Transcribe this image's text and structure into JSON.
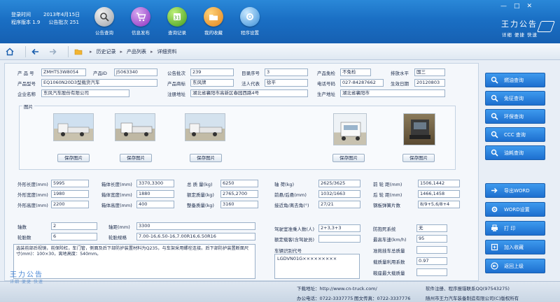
{
  "header": {
    "login_time_label": "登录时间",
    "login_time_value": "2013年4月15日",
    "version_label": "程序版本 1.9",
    "announce_label": "公告批次 251",
    "nav": [
      {
        "label": "公告查询",
        "icon": "search-car-icon"
      },
      {
        "label": "信息发布",
        "icon": "cart-icon"
      },
      {
        "label": "查询记录",
        "icon": "calendar-icon"
      },
      {
        "label": "我的收藏",
        "icon": "folder-icon"
      },
      {
        "label": "程序设置",
        "icon": "gear-icon"
      }
    ],
    "brand_title": "王力公告",
    "brand_slogan": "详细 便捷 快速",
    "window_controls": [
      "—",
      "□",
      "✕"
    ]
  },
  "toolbar": {
    "history": "历史记录",
    "product_list": "产品列表",
    "detail": "详细资料"
  },
  "fields_top": [
    {
      "label": "产 品 号",
      "value": "ZMHT53W8054"
    },
    {
      "label": "产品ID",
      "value": "J5063340"
    },
    {
      "label": "公告批次",
      "value": "239"
    },
    {
      "label": "目录序号",
      "value": "3"
    },
    {
      "label": "产品免检",
      "value": "不免检"
    },
    {
      "label": "排放水平",
      "value": "国三"
    },
    {
      "label": "产品型号",
      "value": "EQ1060N20D3型载货汽车"
    },
    {
      "label": "产品商标",
      "value": "东风牌"
    },
    {
      "label": "法人代表",
      "value": "徐平"
    },
    {
      "label": "电话号码",
      "value": "027-84287662"
    },
    {
      "label": "生效日期",
      "value": "20120803"
    },
    {
      "label": "企业名称",
      "value": "东风汽车股份有限公司"
    },
    {
      "label": "注册地址",
      "value": "湖北省襄阳市高新区春园西路4号"
    },
    {
      "label": "生产地址",
      "value": "湖北省襄阳市"
    }
  ],
  "photos": {
    "title": "图片",
    "save_label": "保存图片"
  },
  "specs_left": [
    {
      "label": "外形长度(mm)",
      "value": "5995"
    },
    {
      "label": "外形宽度(mm)",
      "value": "1980"
    },
    {
      "label": "外形高度(mm)",
      "value": "2200"
    }
  ],
  "specs_box": [
    {
      "label": "箱体长度(mm)",
      "value": "3370,3300"
    },
    {
      "label": "箱体宽度(mm)",
      "value": "1880"
    },
    {
      "label": "箱体高度(mm)",
      "value": "400"
    }
  ],
  "specs_mass": [
    {
      "label": "总 质 量(kg)",
      "value": "6250"
    },
    {
      "label": "额定质量(kg)",
      "value": "2765,2700"
    },
    {
      "label": "整备质量(kg)",
      "value": "3160"
    }
  ],
  "specs_axle": [
    {
      "label": "轴 荷(kg)",
      "value": "2625/3625"
    },
    {
      "label": "前悬/后悬(mm)",
      "value": "1032/1663"
    },
    {
      "label": "接近角/离去角(°)",
      "value": "27/21"
    }
  ],
  "specs_track": [
    {
      "label": "前 轮 距(mm)",
      "value": "1506,1442"
    },
    {
      "label": "后 轮 距(mm)",
      "value": "1466,1458"
    },
    {
      "label": "钢板弹簧片数",
      "value": "8/9+5,6/8+4"
    }
  ],
  "axles": {
    "label": "轴数",
    "value": "2"
  },
  "wheelbase": {
    "label": "轴距(mm)",
    "value": "3300"
  },
  "tires_count": {
    "label": "轮胎数",
    "value": "6"
  },
  "tire_spec": {
    "label": "轮胎规格",
    "value": "7.00-16,6.50-16,7.00R16,6.50R16"
  },
  "cab_passengers": {
    "label": "驾驶室准乘人数(人)",
    "value": "2+3,3+3"
  },
  "rated_passengers": {
    "label": "额定载客(含驾驶员)",
    "value": ""
  },
  "abs": {
    "label": "防抱死系统",
    "value": "无"
  },
  "max_speed": {
    "label": "最高车速(km/h)",
    "value": "95"
  },
  "trailer_mass": {
    "label": "准拖挂车总质量",
    "value": ""
  },
  "load_util": {
    "label": "载质量利用系数",
    "value": "0.97"
  },
  "saddle_mass": {
    "label": "鞍座最大载质量",
    "value": ""
  },
  "vin": {
    "label": "车辆识别代号",
    "value": "LGDVN01G×××××××××"
  },
  "notes": "选装前部后视镜，前保险杠，车门管，侧面及后下部防护装置材料为Q235，与车架采用螺栓连接。后下部防护装置断面尺寸(mm)：100×30，离地高度：540mm。",
  "right_buttons": [
    {
      "label": "燃油查询",
      "icon": "search-icon"
    },
    {
      "label": "免征查询",
      "icon": "search-icon"
    },
    {
      "label": "环保查询",
      "icon": "search-icon"
    },
    {
      "label": "CCC 查询",
      "icon": "search-icon"
    },
    {
      "label": "油耗查询",
      "icon": "search-icon"
    },
    {
      "label": "导出WORD",
      "icon": "export-icon"
    },
    {
      "label": "WORD设置",
      "icon": "gear-icon"
    },
    {
      "label": "打 印",
      "icon": "print-icon"
    },
    {
      "label": "加入收藏",
      "icon": "favorite-icon"
    },
    {
      "label": "返回上级",
      "icon": "back-icon"
    }
  ],
  "footer": {
    "brand_title": "王力公告",
    "brand_slogan": "详细 便捷 快速",
    "download": "下载地址：http://www.cn-truck.com/",
    "phone": "办公电话：0722-3337775",
    "fax": "图文传真：0722-3337776",
    "service": "软件注册、程序报错联系QQ(97543275)",
    "copyright": "随州市王力汽车装备制造有限公司(C)版权所有"
  }
}
